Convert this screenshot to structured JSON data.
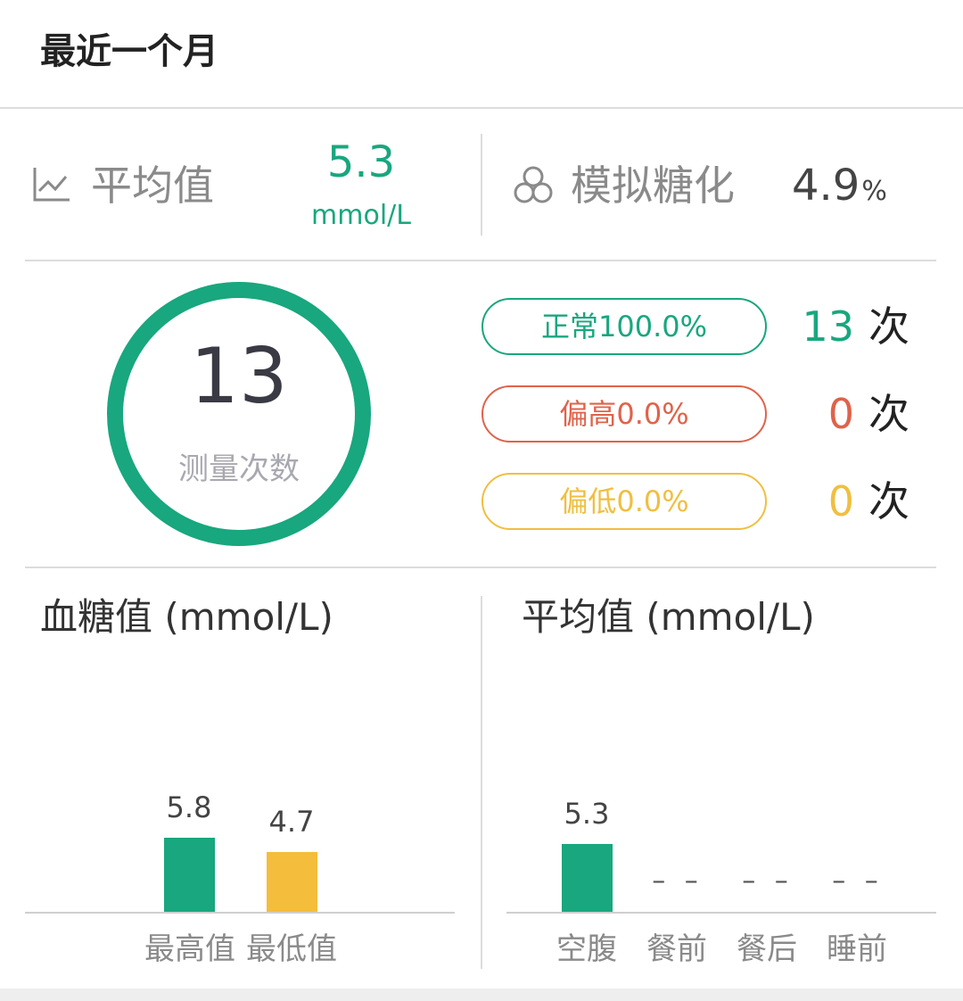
{
  "header": {
    "title": "最近一个月"
  },
  "summary": {
    "avg_icon": "line-chart-icon",
    "avg_label": "平均值",
    "avg_value": "5.3",
    "avg_unit": "mmol/L",
    "hba_icon": "circles-icon",
    "hba_label": "模拟糖化",
    "hba_value": "4.9",
    "hba_unit": "%"
  },
  "measure": {
    "count": "13",
    "label": "测量次数"
  },
  "categories": [
    {
      "label": "正常100.0%",
      "count": "13",
      "unit": "次",
      "color": "#18a77e"
    },
    {
      "label": "偏高0.0%",
      "count": "0",
      "unit": "次",
      "color": "#e0624a"
    },
    {
      "label": "偏低0.0%",
      "count": "0",
      "unit": "次",
      "color": "#f0bf40"
    }
  ],
  "chart_data": [
    {
      "type": "bar",
      "title": "血糖值 (mmol/L)",
      "categories": [
        "最高值",
        "最低值"
      ],
      "values": [
        5.8,
        4.7
      ],
      "value_labels": [
        "5.8",
        "4.7"
      ],
      "colors": [
        "#18a77e",
        "#f4bd3c"
      ]
    },
    {
      "type": "bar",
      "title": "平均值 (mmol/L)",
      "categories": [
        "空腹",
        "餐前",
        "餐后",
        "睡前"
      ],
      "values": [
        5.3,
        null,
        null,
        null
      ],
      "value_labels": [
        "5.3",
        "– –",
        "– –",
        "– –"
      ],
      "colors": [
        "#18a77e"
      ]
    }
  ]
}
